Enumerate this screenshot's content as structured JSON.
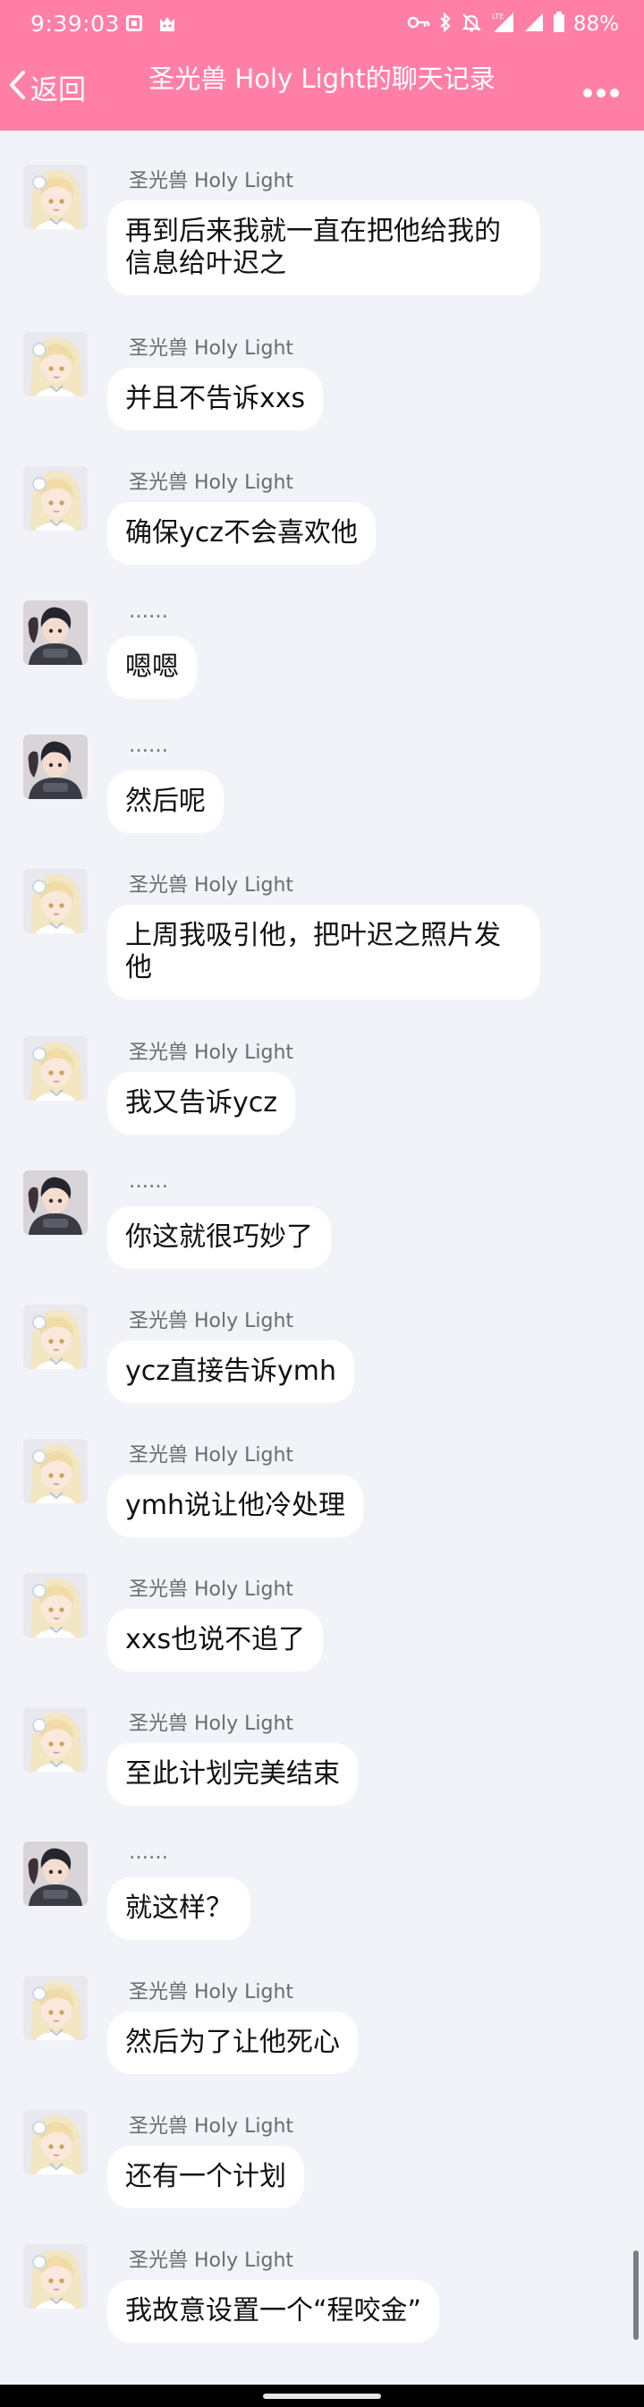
{
  "status_bar": {
    "time": "9:39:03",
    "battery": "88%",
    "icons": [
      "screenshot-icon",
      "cat-icon",
      "key-icon",
      "bluetooth-icon",
      "mute-icon",
      "lte-signal-icon",
      "signal-icon",
      "battery-icon"
    ]
  },
  "header": {
    "back_label": "返回",
    "title": "圣光兽 Holy Light的聊天记录",
    "more_icon": "more-dots-icon"
  },
  "colors": {
    "header_bg": "#ff7fa7",
    "page_bg": "#f2f3f8",
    "bubble_bg": "#ffffff"
  },
  "messages": [
    {
      "avatar": "blonde-girl-avatar",
      "sender": "圣光兽 Holy Light",
      "text": "再到后来我就一直在把他给我的信息给叶迟之"
    },
    {
      "avatar": "blonde-girl-avatar",
      "sender": "圣光兽 Holy Light",
      "text": "并且不告诉xxs"
    },
    {
      "avatar": "blonde-girl-avatar",
      "sender": "圣光兽 Holy Light",
      "text": "确保ycz不会喜欢他"
    },
    {
      "avatar": "dark-hair-boy-avatar",
      "sender": "……",
      "text": "嗯嗯"
    },
    {
      "avatar": "dark-hair-boy-avatar",
      "sender": "……",
      "text": "然后呢"
    },
    {
      "avatar": "blonde-girl-avatar",
      "sender": "圣光兽 Holy Light",
      "text": "上周我吸引他，把叶迟之照片发他"
    },
    {
      "avatar": "blonde-girl-avatar",
      "sender": "圣光兽 Holy Light",
      "text": "我又告诉ycz"
    },
    {
      "avatar": "dark-hair-boy-avatar",
      "sender": "……",
      "text": "你这就很巧妙了"
    },
    {
      "avatar": "blonde-girl-avatar",
      "sender": "圣光兽 Holy Light",
      "text": "ycz直接告诉ymh"
    },
    {
      "avatar": "blonde-girl-avatar",
      "sender": "圣光兽 Holy Light",
      "text": "ymh说让他冷处理"
    },
    {
      "avatar": "blonde-girl-avatar",
      "sender": "圣光兽 Holy Light",
      "text": "xxs也说不追了"
    },
    {
      "avatar": "blonde-girl-avatar",
      "sender": "圣光兽 Holy Light",
      "text": "至此计划完美结束"
    },
    {
      "avatar": "dark-hair-boy-avatar",
      "sender": "……",
      "text": "就这样？"
    },
    {
      "avatar": "blonde-girl-avatar",
      "sender": "圣光兽 Holy Light",
      "text": "然后为了让他死心"
    },
    {
      "avatar": "blonde-girl-avatar",
      "sender": "圣光兽 Holy Light",
      "text": "还有一个计划"
    },
    {
      "avatar": "blonde-girl-avatar",
      "sender": "圣光兽 Holy Light",
      "text": "我故意设置一个“程咬金”"
    }
  ]
}
